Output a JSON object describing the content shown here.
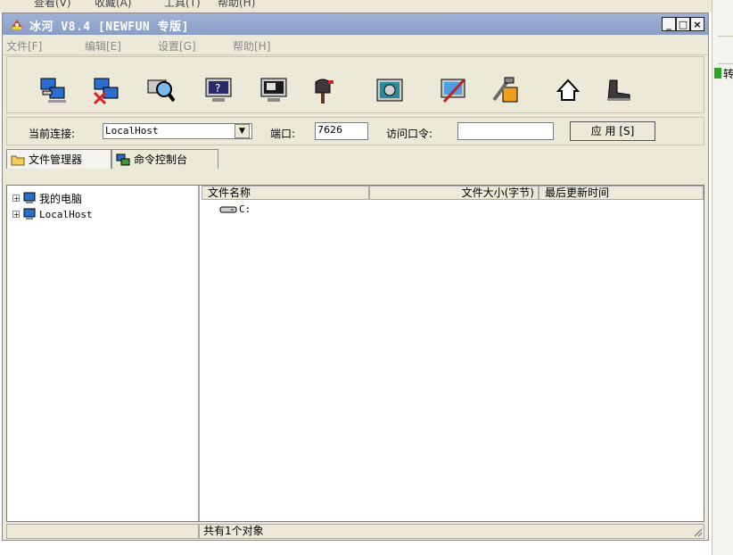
{
  "background_menu": {
    "items": [
      "查看(V)",
      "收藏(A)",
      "工具(T)",
      "帮助(H)"
    ],
    "right_char": "转"
  },
  "window": {
    "title": "冰河 V8.4 [NEWFUN 专版]",
    "buttons": {
      "minimize": "_",
      "maximize": "□",
      "close": "×"
    }
  },
  "menubar": {
    "items": [
      "文件[F]",
      "编辑[E]",
      "设置[G]",
      "帮助[H]"
    ]
  },
  "toolbar": {
    "icons": [
      "connect-computer-icon",
      "disconnect-computer-icon",
      "search-computer-icon",
      "help-monitor-icon",
      "screen-capture-icon",
      "mailbox-icon",
      "control-panel-icon",
      "config-server-icon",
      "tools-icon",
      "home-icon",
      "exit-boot-icon"
    ]
  },
  "connection": {
    "current_label": "当前连接:",
    "current_value": "LocalHost",
    "port_label": "端口:",
    "port_value": "7626",
    "password_label": "访问口令:",
    "password_value": "",
    "apply_label": "应 用 [S]"
  },
  "tabs": [
    {
      "label": "文件管理器",
      "icon": "folder-icon",
      "active": true
    },
    {
      "label": "命令控制台",
      "icon": "console-icon",
      "active": false
    }
  ],
  "tree": [
    {
      "label": "我的电脑",
      "expander": "+"
    },
    {
      "label": "LocalHost",
      "expander": "+"
    }
  ],
  "list": {
    "columns": [
      "文件名称",
      "文件大小(字节)",
      "最后更新时间"
    ],
    "rows": [
      {
        "name": "C:"
      }
    ]
  },
  "status": {
    "left": "",
    "message": "共有1个对象"
  }
}
